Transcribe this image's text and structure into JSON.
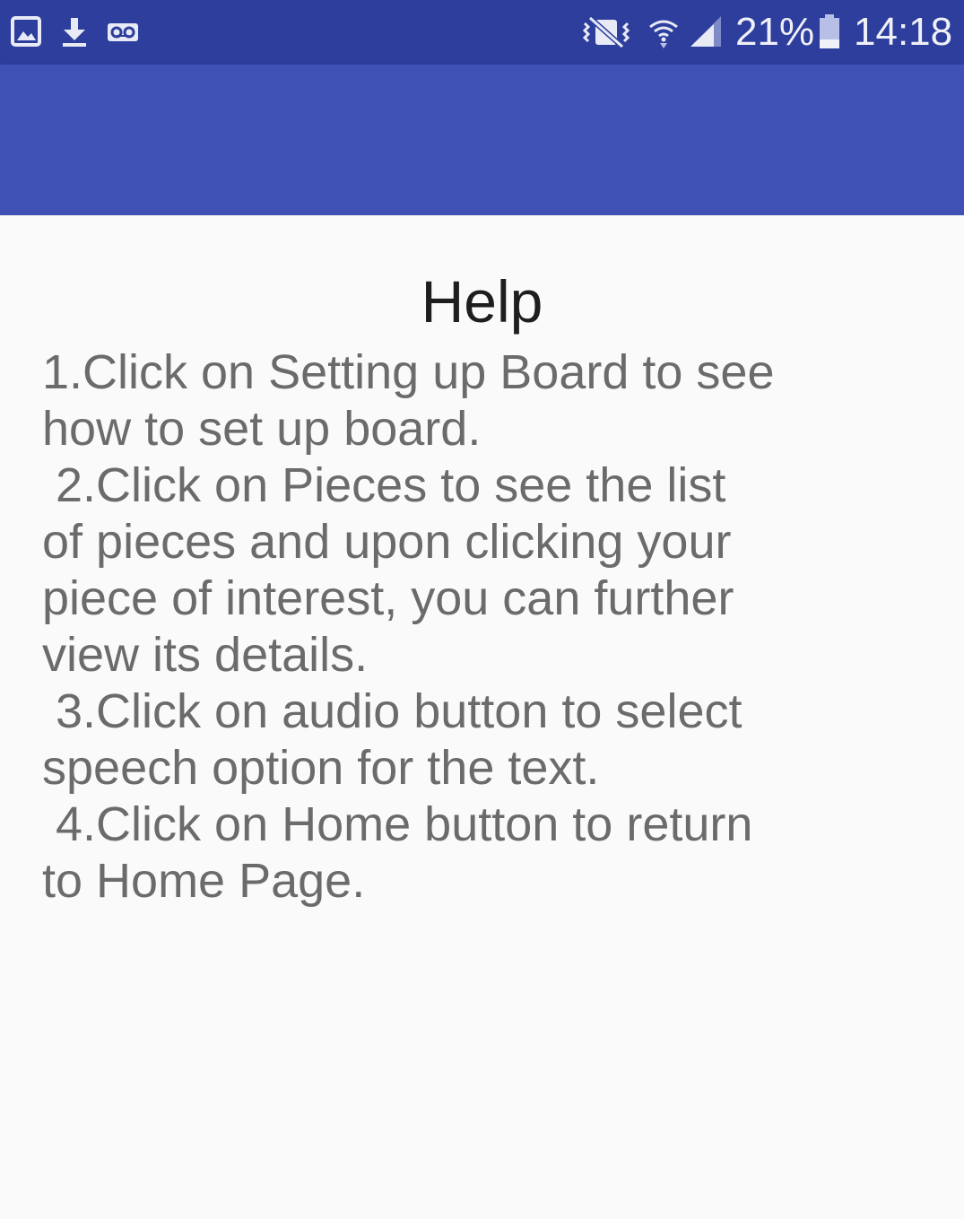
{
  "status_bar": {
    "left_icons": [
      "gallery-icon",
      "download-icon",
      "voicemail-icon"
    ],
    "right_icons": [
      "vibrate-icon",
      "wifi-icon",
      "signal-icon",
      "battery-icon"
    ],
    "battery_percent": "21%",
    "time": "14:18",
    "background_color": "#2d3e9c"
  },
  "app_bar": {
    "background_color": "#3f51b5"
  },
  "help": {
    "title": "Help",
    "body": "1.Click on Setting up Board to see how to set up board.\n 2.Click on Pieces to see the list of pieces and upon clicking your piece of interest, you can further view its details.\n 3.Click on audio button to select speech option for the text.\n 4.Click on Home button to return to Home Page."
  }
}
